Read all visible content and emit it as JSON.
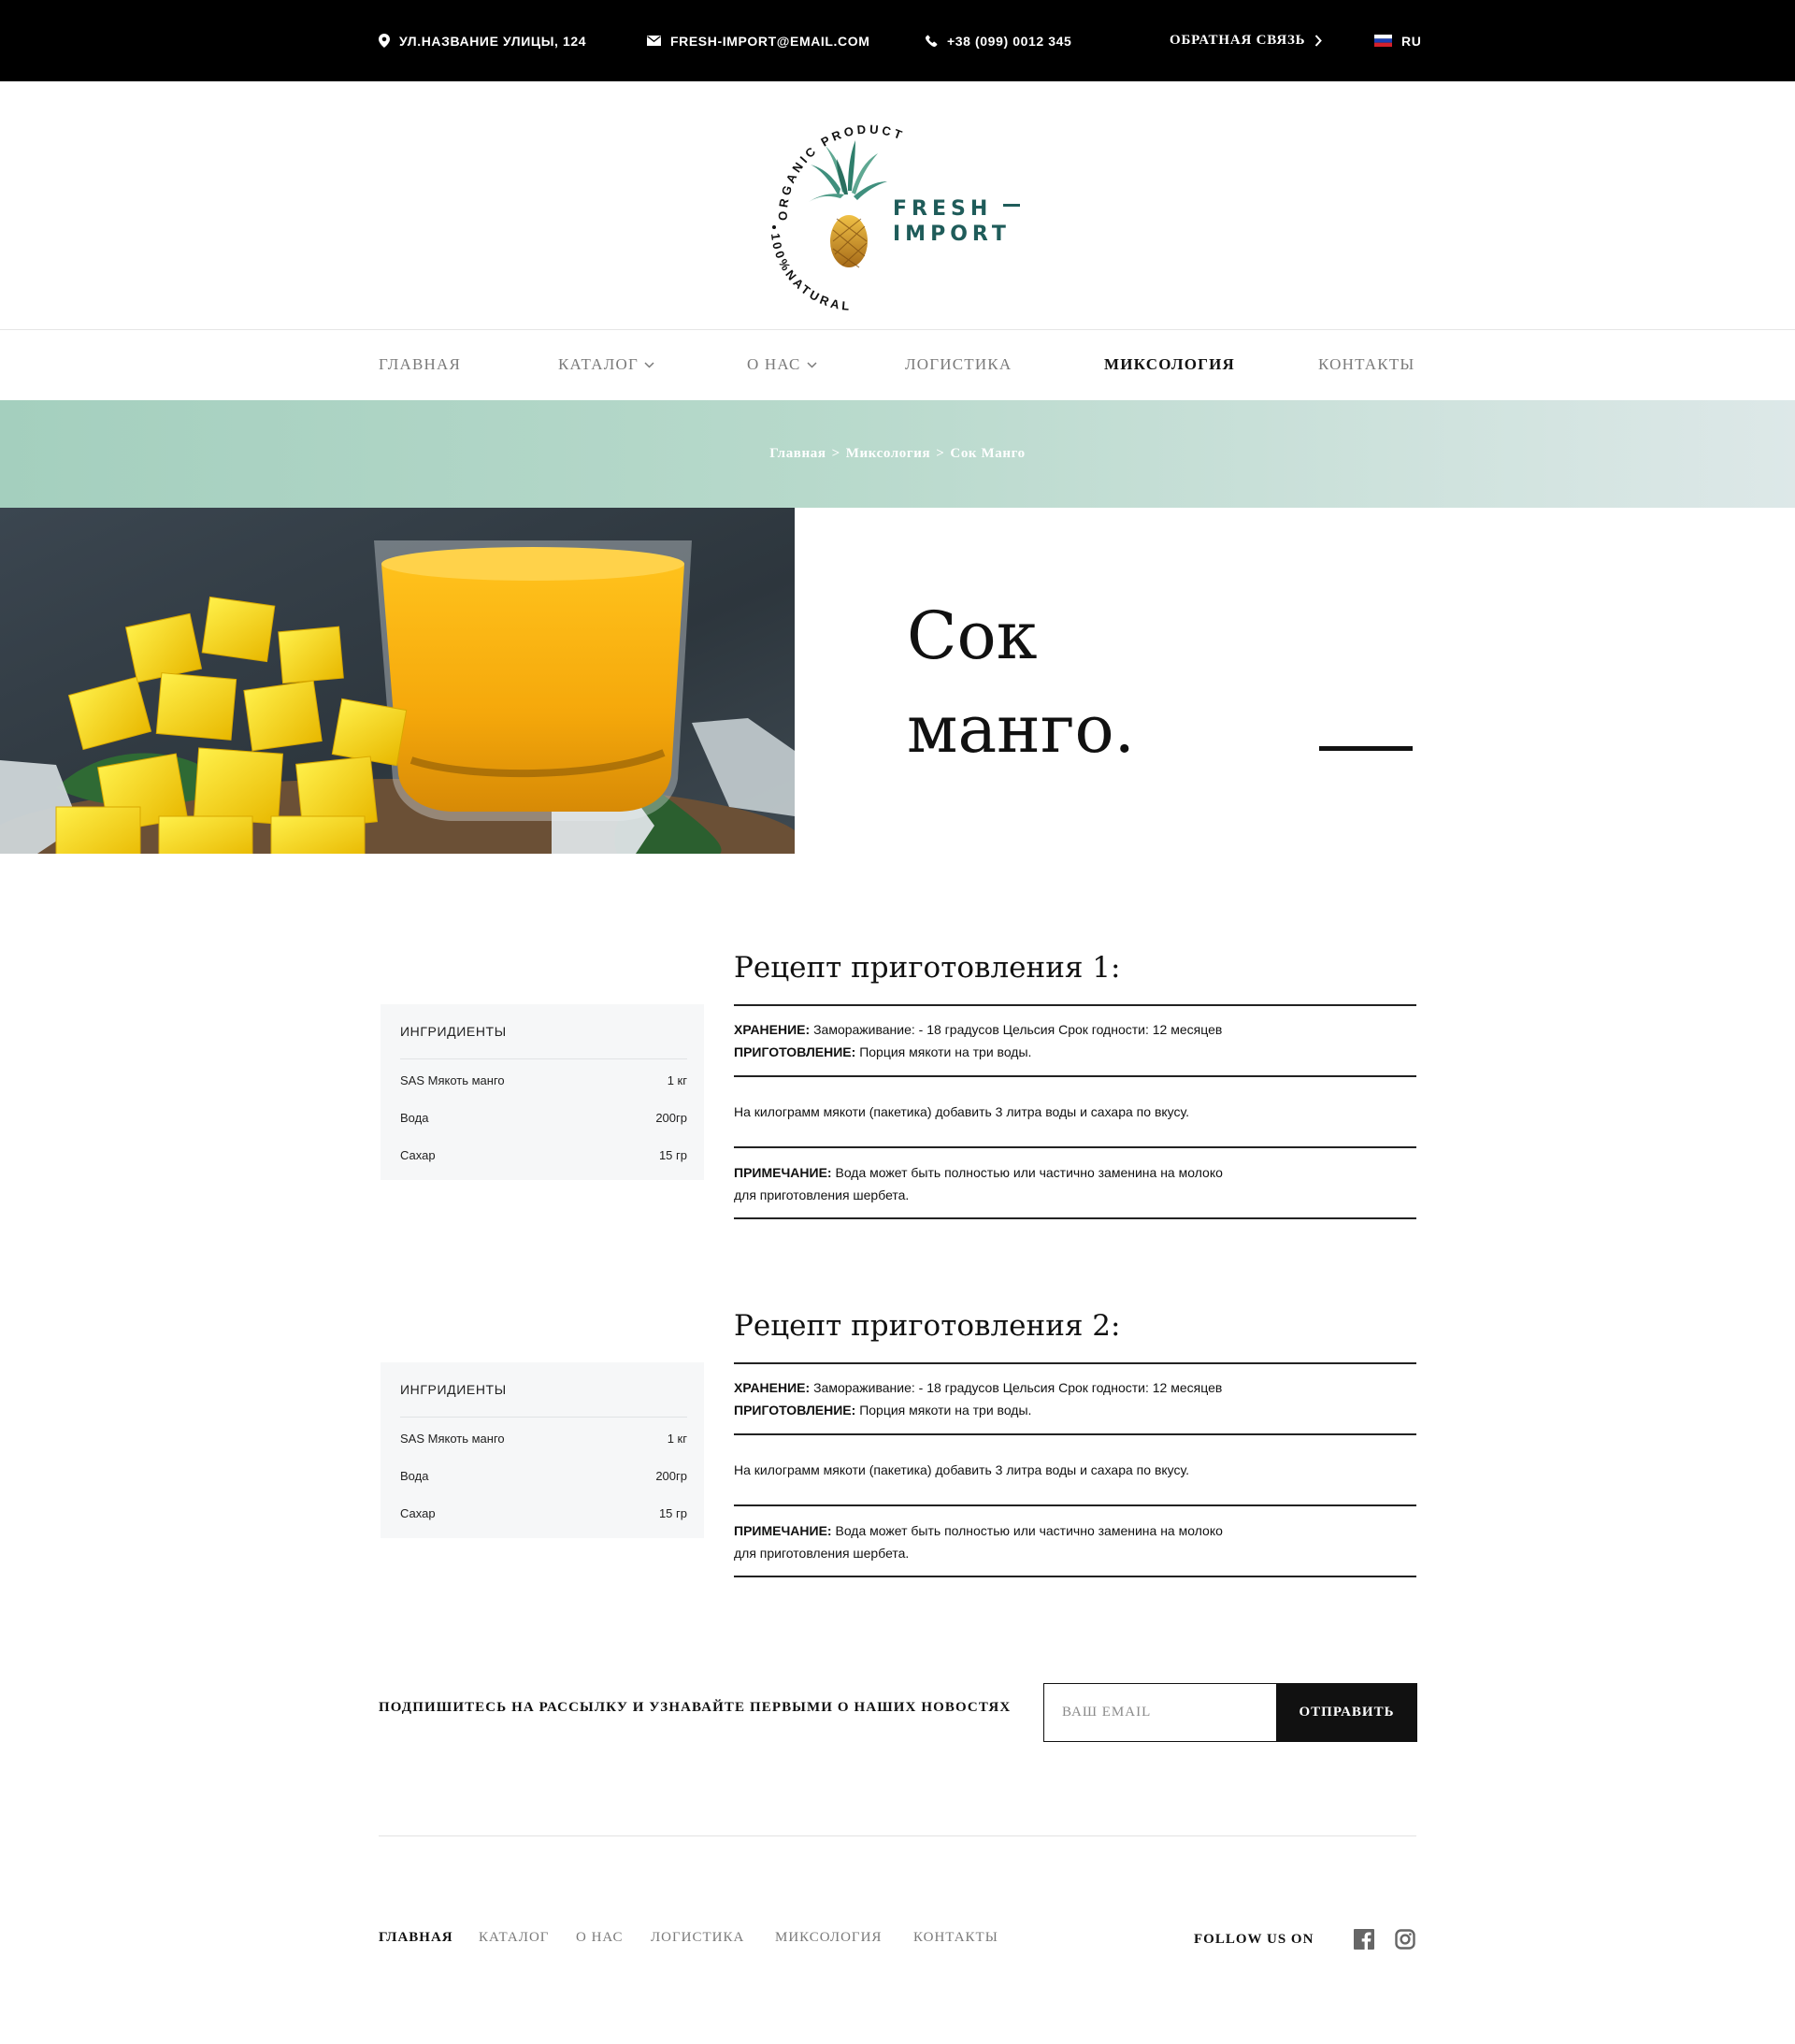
{
  "topbar": {
    "address": "УЛ.НАЗВАНИЕ УЛИЦЫ, 124",
    "email": "FRESH-IMPORT@EMAIL.COM",
    "phone": "+38 (099) 0012 345",
    "feedback": "ОБРАТНАЯ СВЯЗЬ",
    "language": "RU"
  },
  "logo": {
    "ring_top": "ORGANIC PRODUCT",
    "ring_bottom": "100%NATURAL",
    "line1": "FRESH",
    "line2": "IMPORT"
  },
  "nav": {
    "items": [
      {
        "label": "ГЛАВНАЯ"
      },
      {
        "label": "КАТАЛОГ"
      },
      {
        "label": "О НАС"
      },
      {
        "label": "ЛОГИСТИКА"
      },
      {
        "label": "МИКСОЛОГИЯ"
      },
      {
        "label": "КОНТАКТЫ"
      }
    ],
    "active": "МИКСОЛОГИЯ"
  },
  "breadcrumb": {
    "items": [
      "Главная",
      "Миксология",
      "Сок Манго"
    ],
    "separator": ">"
  },
  "hero": {
    "title_line1": "Сок",
    "title_line2": "манго."
  },
  "recipes": [
    {
      "title": "Рецепт приготовления 1:",
      "ingredients_title": "ИНГРИДИЕНТЫ",
      "ingredients": [
        {
          "name": "SAS Мякоть манго",
          "amount": "1 кг"
        },
        {
          "name": "Вода",
          "amount": "200гр"
        },
        {
          "name": "Сахар",
          "amount": "15 гр"
        }
      ],
      "storage_label": "ХРАНЕНИЕ:",
      "storage_text": "Замораживание: - 18 градусов Цельсия Срок годности: 12 месяцев",
      "prep_label": "ПРИГОТОВЛЕНИЕ:",
      "prep_text": "Порция мякоти на три воды.",
      "step": "На килограмм мякоти (пакетика) добавить 3 литра воды и сахара по вкусу.",
      "note_label": "ПРИМЕЧАНИЕ:",
      "note_text": "Вода может быть полностью или частично заменина на молоко",
      "note_text2": "для приготовления шербета."
    },
    {
      "title": "Рецепт приготовления 2:",
      "ingredients_title": "ИНГРИДИЕНТЫ",
      "ingredients": [
        {
          "name": "SAS Мякоть манго",
          "amount": "1 кг"
        },
        {
          "name": "Вода",
          "amount": "200гр"
        },
        {
          "name": "Сахар",
          "amount": "15 гр"
        }
      ],
      "storage_label": "ХРАНЕНИЕ:",
      "storage_text": "Замораживание: - 18 градусов Цельсия Срок годности: 12 месяцев",
      "prep_label": "ПРИГОТОВЛЕНИЕ:",
      "prep_text": "Порция мякоти на три воды.",
      "step": "На килограмм мякоти (пакетика) добавить 3 литра воды и сахара по вкусу.",
      "note_label": "ПРИМЕЧАНИЕ:",
      "note_text": "Вода может быть полностью или частично заменина на молоко",
      "note_text2": "для приготовления шербета."
    }
  ],
  "newsletter": {
    "label": "ПОДПИШИТЕСЬ НА РАССЫЛКУ И УЗНАВАЙТЕ ПЕРВЫМИ О НАШИХ НОВОСТЯХ",
    "placeholder": "ВАШ EMAIL",
    "button": "ОТПРАВИТЬ"
  },
  "footer": {
    "nav": [
      "ГЛАВНАЯ",
      "КАТАЛОГ",
      "О НАС",
      "ЛОГИСТИКА",
      "МИКСОЛОГИЯ",
      "КОНТАКТЫ"
    ],
    "active": "ГЛАВНАЯ",
    "follow": "FOLLOW US ON",
    "social": [
      "facebook-icon",
      "instagram-icon"
    ]
  },
  "colors": {
    "brand_teal": "#1f5c5a",
    "band_start": "#a4cfbe",
    "band_end": "#dde8e8",
    "mango": "#f7c21c"
  }
}
